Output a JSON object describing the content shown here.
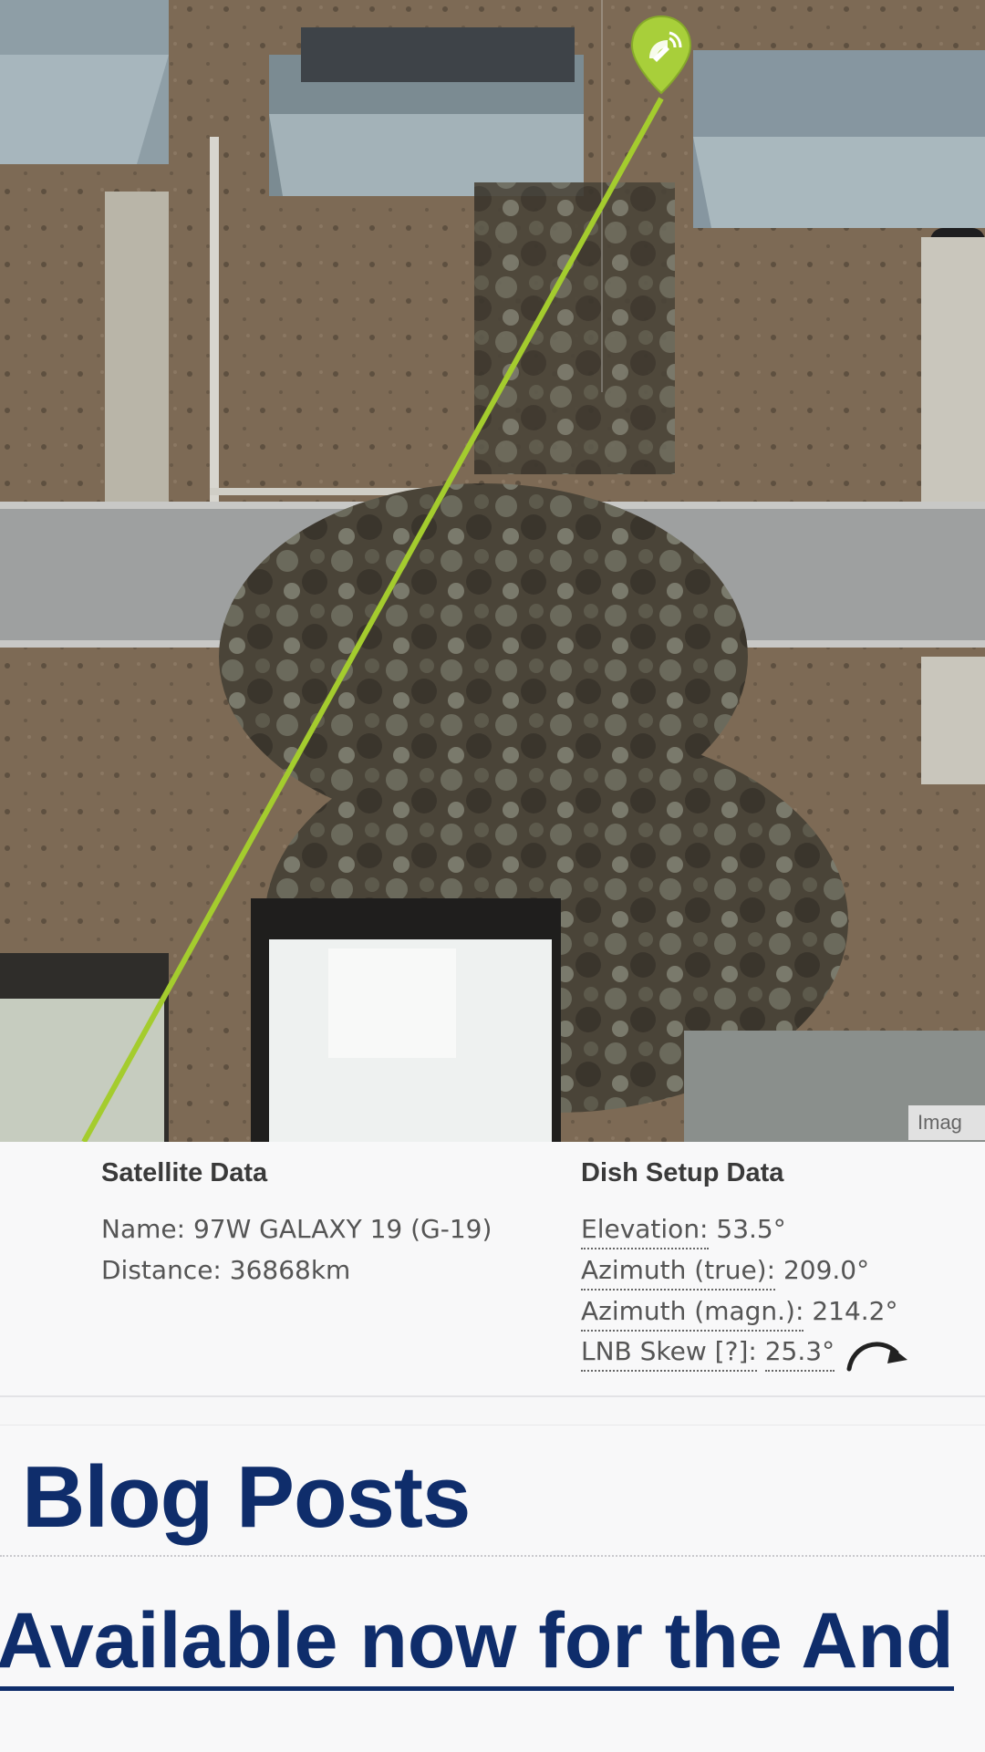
{
  "map": {
    "attribution": "Imag",
    "marker_icon": "satellite-pin-icon",
    "colors": {
      "line": "#a4cc2e",
      "marker": "#a8cf3a"
    }
  },
  "satellite": {
    "heading": "Satellite Data",
    "name_line": "Name: 97W GALAXY 19 (G-19)",
    "distance_line": "Distance: 36868km"
  },
  "dish": {
    "heading": "Dish Setup Data",
    "elevation_label": "Elevation:",
    "elevation_value": "53.5°",
    "azimuth_true_label": "Azimuth (true):",
    "azimuth_true_value": "209.0°",
    "azimuth_magn_label": "Azimuth (magn.):",
    "azimuth_magn_value": "214.2°",
    "skew_label": "LNB Skew [?]:",
    "skew_value": "25.3°",
    "skew_icon": "clockwise-arrow-icon"
  },
  "blog": {
    "title": "Blog Posts",
    "post_title": "Available now for the And"
  }
}
